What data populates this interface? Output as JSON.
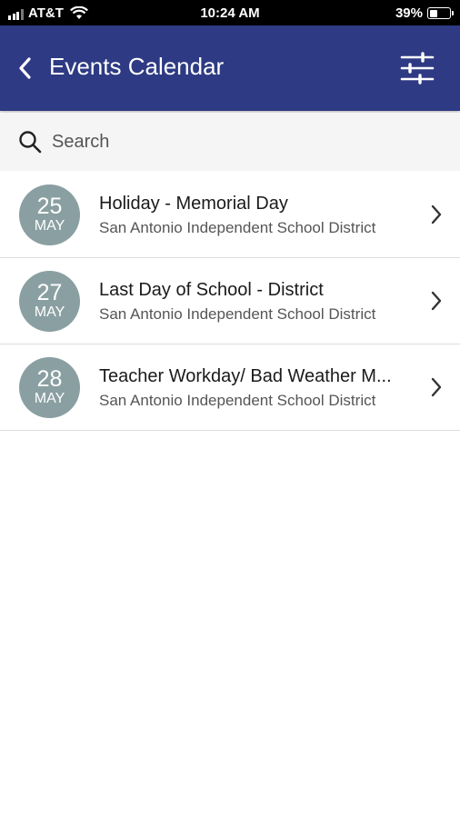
{
  "status_bar": {
    "carrier": "AT&T",
    "time": "10:24 AM",
    "battery": "39%",
    "battery_level": 0.39
  },
  "nav": {
    "title": "Events Calendar",
    "back_icon": "chevron-left-icon",
    "filter_icon": "sliders-icon",
    "background": "#2e3a83"
  },
  "search": {
    "placeholder": "Search",
    "value": ""
  },
  "events": [
    {
      "day": "25",
      "month": "MAY",
      "title": "Holiday - Memorial Day",
      "subtitle": "San Antonio Independent School District"
    },
    {
      "day": "27",
      "month": "MAY",
      "title": "Last Day of School - District",
      "subtitle": "San Antonio Independent School District"
    },
    {
      "day": "28",
      "month": "MAY",
      "title": "Teacher Workday/ Bad Weather M...",
      "subtitle": "San Antonio Independent School District"
    }
  ],
  "colors": {
    "date_badge": "#8a9fa1",
    "accent": "#2e3a83"
  }
}
